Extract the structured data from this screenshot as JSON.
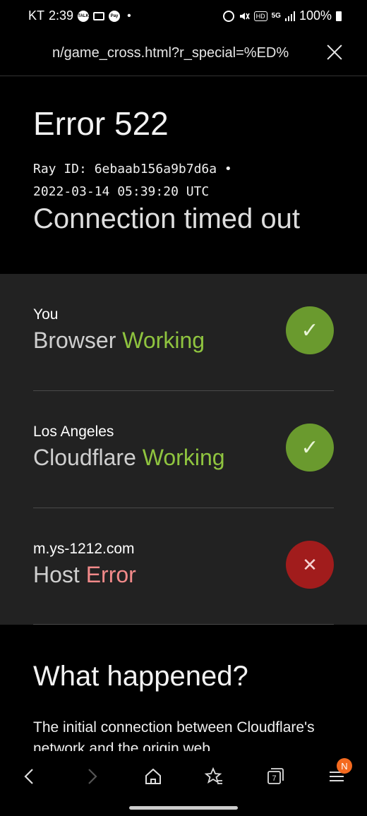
{
  "status_bar": {
    "carrier": "KT",
    "time": "2:39",
    "notif_talk": "TALK",
    "notif_pay": "Pay",
    "network": "5G",
    "hd": "HD",
    "battery": "100%"
  },
  "url_bar": {
    "url": "n/game_cross.html?r_special=%ED%"
  },
  "error": {
    "title": "Error 522",
    "ray_line1": "Ray ID: 6ebaab156a9b7d6a •",
    "ray_line2": "2022-03-14 05:39:20 UTC",
    "subtitle": "Connection timed out"
  },
  "status_rows": [
    {
      "location": "You",
      "name": "Browser",
      "state": "Working",
      "icon": "check-icon"
    },
    {
      "location": "Los Angeles",
      "name": "Cloudflare",
      "state": "Working",
      "icon": "check-icon"
    },
    {
      "location": "m.ys-1212.com",
      "name": "Host",
      "state": "Error",
      "icon": "x-icon"
    }
  ],
  "what_happened": {
    "heading": "What happened?",
    "text": "The initial connection between Cloudflare's network and the origin web"
  },
  "nav": {
    "tabs_count": "7",
    "menu_badge": "N"
  },
  "colors": {
    "working": "#8fc43f",
    "error": "#f28a8a",
    "panel_bg": "#222222"
  }
}
